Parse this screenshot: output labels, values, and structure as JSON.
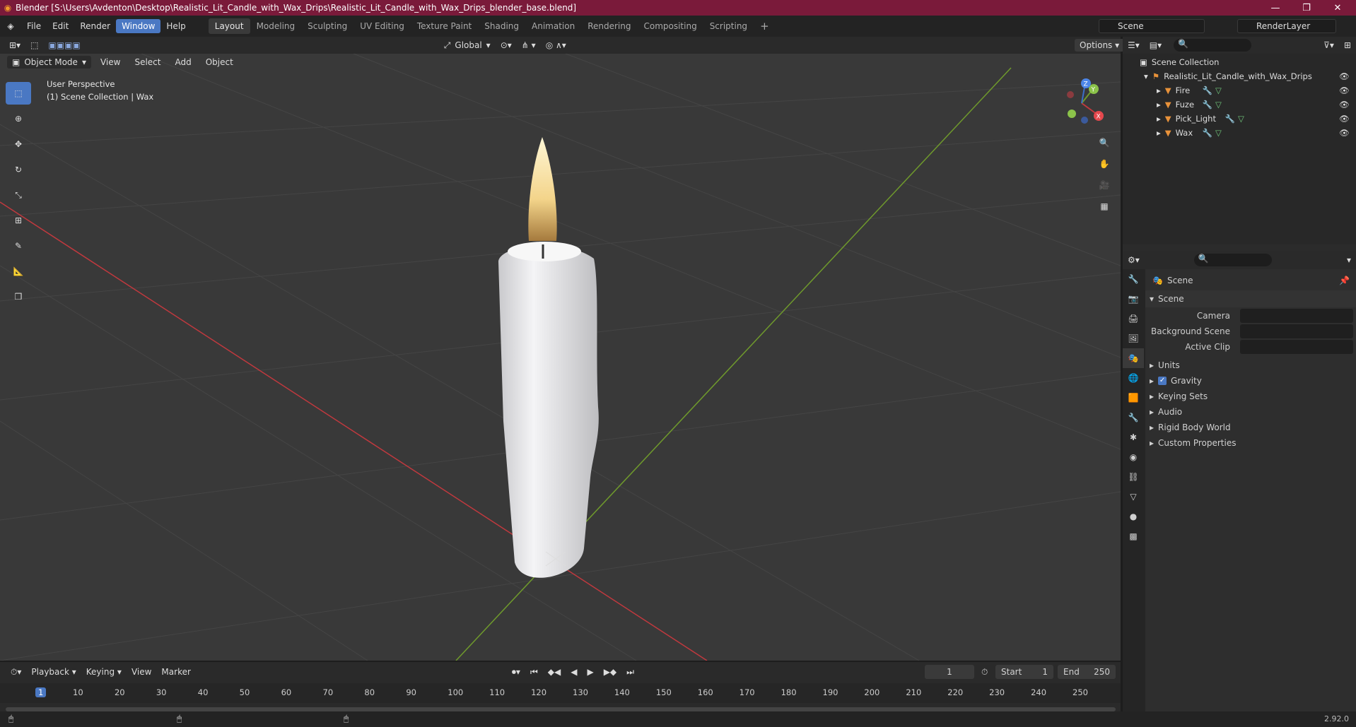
{
  "window": {
    "title": "Blender [S:\\Users\\Avdenton\\Desktop\\Realistic_Lit_Candle_with_Wax_Drips\\Realistic_Lit_Candle_with_Wax_Drips_blender_base.blend]"
  },
  "menu": [
    "File",
    "Edit",
    "Render",
    "Window",
    "Help"
  ],
  "workspaces": [
    "Layout",
    "Modeling",
    "Sculpting",
    "UV Editing",
    "Texture Paint",
    "Shading",
    "Animation",
    "Rendering",
    "Compositing",
    "Scripting"
  ],
  "scene_selector": {
    "scene": "Scene",
    "render_layer": "RenderLayer"
  },
  "viewport_header": {
    "mode": "Object Mode",
    "menus": [
      "View",
      "Select",
      "Add",
      "Object"
    ],
    "orientation": "Global",
    "options": "Options"
  },
  "viewport": {
    "perspective": "User Perspective",
    "collection": "(1) Scene Collection | Wax"
  },
  "gizmo": {
    "x": "X",
    "y": "Y",
    "z": "Z"
  },
  "outliner": {
    "root": "Scene Collection",
    "collection": "Realistic_Lit_Candle_with_Wax_Drips",
    "objects": [
      "Fire",
      "Fuze",
      "Pick_Light",
      "Wax"
    ]
  },
  "properties": {
    "header": "Scene",
    "section": "Scene",
    "fields": [
      {
        "label": "Camera"
      },
      {
        "label": "Background Scene"
      },
      {
        "label": "Active Clip"
      }
    ],
    "panels": [
      {
        "label": "Units",
        "checkbox": false
      },
      {
        "label": "Gravity",
        "checkbox": true
      },
      {
        "label": "Keying Sets",
        "checkbox": false
      },
      {
        "label": "Audio",
        "checkbox": false
      },
      {
        "label": "Rigid Body World",
        "checkbox": false
      },
      {
        "label": "Custom Properties",
        "checkbox": false
      }
    ]
  },
  "timeline": {
    "menus": [
      "Playback",
      "Keying",
      "View",
      "Marker"
    ],
    "current_frame": "1",
    "start_label": "Start",
    "start": "1",
    "end_label": "End",
    "end": "250",
    "ticks": [
      "1",
      "10",
      "20",
      "30",
      "40",
      "50",
      "60",
      "70",
      "80",
      "90",
      "100",
      "110",
      "120",
      "130",
      "140",
      "150",
      "160",
      "170",
      "180",
      "190",
      "200",
      "210",
      "220",
      "230",
      "240",
      "250"
    ]
  },
  "status": {
    "version": "2.92.0"
  },
  "colors": {
    "accent": "#4a78c3",
    "titlebar": "#7a1a3a",
    "object_orange": "#e8923a",
    "axis_red": "#c0393e",
    "axis_green": "#6f9a2c"
  }
}
